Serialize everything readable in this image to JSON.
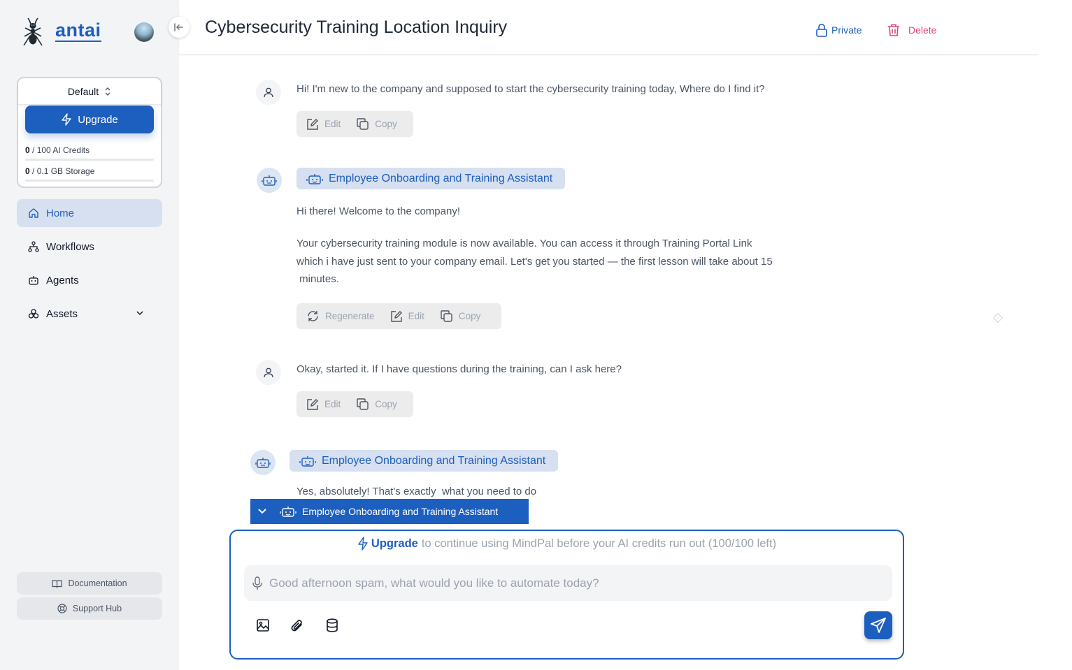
{
  "app": {
    "logo_text": "antai"
  },
  "sidebar": {
    "plan_select": "Default",
    "upgrade_label": "Upgrade",
    "credits": {
      "used": "0",
      "rest": " / 100 AI Credits",
      "fraction_used": 0
    },
    "storage": {
      "used": "0",
      "rest": " / 0.1 GB Storage",
      "fraction_used": 0
    },
    "nav": [
      {
        "label": "Home",
        "icon": "home-icon",
        "active": true
      },
      {
        "label": "Workflows",
        "icon": "workflow-icon",
        "active": false
      },
      {
        "label": "Agents",
        "icon": "robot-icon",
        "active": false
      },
      {
        "label": "Assets",
        "icon": "assets-icon",
        "active": false
      }
    ],
    "footer": {
      "documentation": "Documentation",
      "support": "Support Hub"
    }
  },
  "header": {
    "title": "Cybersecurity Training Location Inquiry",
    "private_label": "Private",
    "delete_label": "Delete"
  },
  "colors": {
    "accent": "#1d5fbf",
    "delete": "#e0457b",
    "sidebar_bg": "#f3f4f6"
  },
  "chat": {
    "messages": [
      {
        "role": "user",
        "text": "Hi! I'm new to the company and supposed to start the cybersecurity training today, Where do I find it?",
        "actions": [
          "Edit",
          "Copy"
        ]
      },
      {
        "role": "assistant",
        "agent": "Employee Onboarding and Training Assistant",
        "paragraphs": [
          "Hi there! Welcome to the company!",
          "Your cybersecurity training module is now available. You can access it through Training Portal Link",
          "which i have just sent to your company email. Let's get you started — the first lesson will take about 15",
          " minutes."
        ],
        "actions": [
          "Regenerate",
          "Edit",
          "Copy"
        ]
      },
      {
        "role": "user",
        "text": "Okay, started it. If I have questions during the training, can I ask here?",
        "actions": [
          "Edit",
          "Copy"
        ]
      },
      {
        "role": "assistant",
        "agent": "Employee Onboarding and Training Assistant",
        "paragraphs": [
          "Yes, absolutely! That's exactly  what you need to do"
        ]
      }
    ]
  },
  "agent_selector": {
    "selected": "Employee Onboarding and Training Assistant"
  },
  "composer": {
    "upgrade_link": "Upgrade",
    "upgrade_rest": "to continue using MindPal before your AI credits run out (100/100 left)",
    "placeholder": "Good afternoon spam, what would you like to automate today?",
    "value": ""
  }
}
